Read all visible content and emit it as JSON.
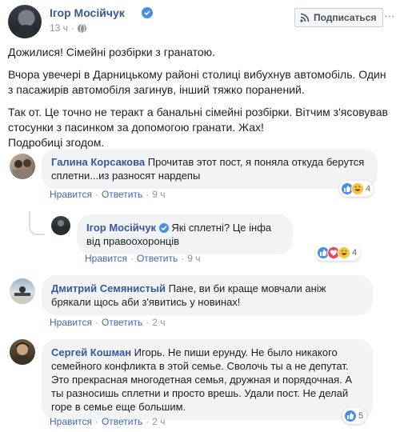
{
  "post": {
    "author": "Ігор Мосійчук",
    "time": "13 ч",
    "follow_label": "Подписаться",
    "paragraphs": [
      "Дожилися! Сімейні розбірки з гранатою.",
      "Вчора увечері в Дарницькому районі столиці вибухнув автомобіль. Один з пасажирів автомобіля загинув, інший тяжко поранений.",
      "Так от. Це точно не теракт а банальні сімейні розбірки. Вітчим з'ясовував стосунки з пасинком за допомогою гранати. Жах!\nПодробиці згодом."
    ]
  },
  "comments": [
    {
      "author": "Галина Корсакова",
      "text": "Прочитав этот пост, я поняла откуда берутся сплетни...из разносят нардепы",
      "like_label": "Нравится",
      "reply_label": "Ответить",
      "time": "9 ч",
      "reaction_count": "4"
    },
    {
      "author": "Ігор Мосійчук",
      "text": "Які сплетні? Це інфа від правоохоронців",
      "like_label": "Нравится",
      "reply_label": "Ответить",
      "time": "9 ч",
      "reaction_count": "4"
    },
    {
      "author": "Дмитрий Семянистый",
      "text": "Пане, ви би краще мовчали аніж брякали щось аби з'явитись у новинах!",
      "like_label": "Нравится",
      "reply_label": "Ответить",
      "time": "2 ч"
    },
    {
      "author": "Сергей Кошман",
      "text": "Игорь. Не пиши ерунду. Не было никакого семейного конфликта в этой семье. Сволочь ты а не депутат. Это прекрасная многодетная семья, дружная и порядочная. А ты разносишь сплетни и просто врешь. Удали пост. Не делай горе в семье еще большим.",
      "like_label": "Нравится",
      "reply_label": "Ответить",
      "time": "2 ч",
      "reaction_count": "5"
    }
  ],
  "separator": "·",
  "colors": {
    "link": "#385898",
    "like": "#4a90e2",
    "love": "#f0405b",
    "haha": "#f7c23f",
    "bubble": "#f2f3f5"
  }
}
